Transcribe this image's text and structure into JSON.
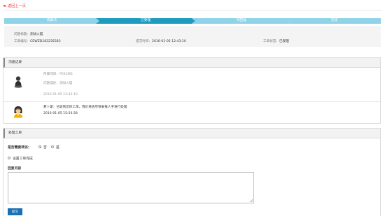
{
  "nav": {
    "back_label": "返回上一页"
  },
  "steps": [
    {
      "label": "待解决",
      "active": false
    },
    {
      "label": "已受理",
      "active": true
    },
    {
      "label": "待回复",
      "active": false
    },
    {
      "label": "完成",
      "active": false
    }
  ],
  "colors": {
    "step_inactive": "#8fd3e8",
    "step_active": "#1e9cc0",
    "accent_red": "#e33333",
    "button_blue": "#1a6fb5"
  },
  "ticket": {
    "title_label": "问题标题：",
    "title_value": "测试火狐",
    "number_label": "工单编号：",
    "number_value": "CEWZD183235583",
    "submit_time_label": "提交时间：",
    "submit_time_value": "2016-01-05 12:43:10",
    "status_label": "工单状态：",
    "status_value": "已受理"
  },
  "communication": {
    "header": "沟通记录",
    "records": [
      {
        "avatar": "user-silhouette-icon",
        "project_label": "所属项目：",
        "project_value": "PESCMS",
        "desc_label": "问题描述：",
        "desc_value": "测试火狐",
        "time": "2016-01-05 12:43:10"
      },
      {
        "avatar": "support-agent-icon",
        "name": "萝卜斯",
        "separator": "：",
        "message": "已收到您的工单，我们将会尽快安排人手进行处理",
        "time": "2016-01-05 15:50:28"
      }
    ]
  },
  "process": {
    "header": "处理工单",
    "transfer_label": "是否需要转派：",
    "option_no": "否",
    "option_yes": "是",
    "complete_label": "设置工单完成",
    "reply_label": "回复内容",
    "reply_value": "",
    "submit_label": "提交"
  }
}
